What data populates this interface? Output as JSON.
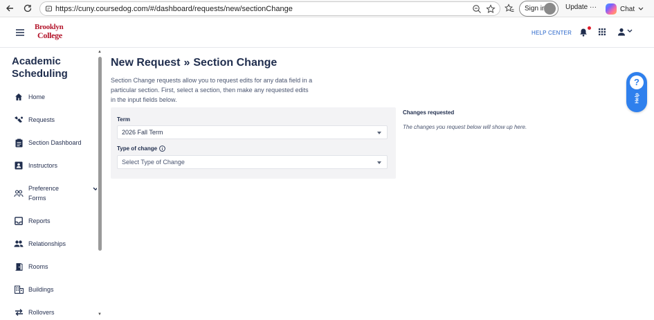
{
  "browser": {
    "url": "https://cuny.coursedog.com/#/dashboard/requests/new/sectionChange",
    "signin_label": "Sign in",
    "update_label": "Update",
    "update_more": "···",
    "chat_label": "Chat"
  },
  "header": {
    "logo_line1": "Brooklyn",
    "logo_line2": "College",
    "help_center": "HELP CENTER"
  },
  "sidebar": {
    "title": "Academic Scheduling",
    "items": [
      {
        "label": "Home",
        "icon": "home-icon"
      },
      {
        "label": "Requests",
        "icon": "requests-icon"
      },
      {
        "label": "Section Dashboard",
        "icon": "clipboard-icon"
      },
      {
        "label": "Instructors",
        "icon": "badge-icon"
      },
      {
        "label": "Preference Forms",
        "icon": "people-icon"
      },
      {
        "label": "Reports",
        "icon": "inbox-icon"
      },
      {
        "label": "Relationships",
        "icon": "group-icon"
      },
      {
        "label": "Rooms",
        "icon": "door-icon"
      },
      {
        "label": "Buildings",
        "icon": "building-icon"
      },
      {
        "label": "Rollovers",
        "icon": "rollover-icon"
      }
    ]
  },
  "main": {
    "title_part1": "New Request",
    "title_sep": "»",
    "title_part2": "Section Change",
    "intro": "Section Change requests allow you to request edits for any data field in a particular section. First, select a section, then make any requested edits in the input fields below.",
    "term_label": "Term",
    "term_value": "2026 Fall Term",
    "type_label": "Type of change",
    "type_placeholder": "Select Type of Change",
    "changes_title": "Changes requested",
    "changes_note": "The changes you request below will show up here."
  },
  "help_widget": {
    "label": "Help",
    "glyph": "?"
  },
  "colors": {
    "accent": "#2f80ed",
    "link": "#2563c9",
    "brand": "#b3152b",
    "heading": "#1f2d4d"
  }
}
